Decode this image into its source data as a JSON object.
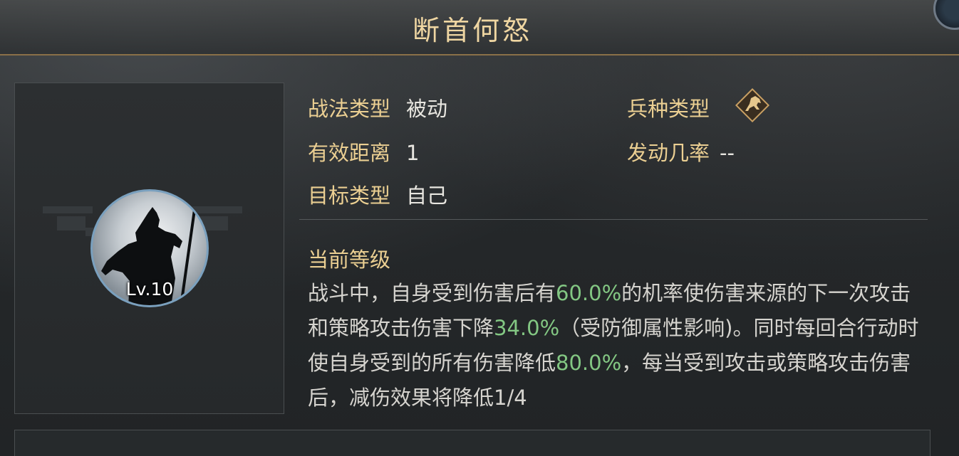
{
  "title": "断首何怒",
  "portrait": {
    "level": "Lv.10"
  },
  "info": {
    "tactic_type_label": "战法类型",
    "tactic_type_value": "被动",
    "range_label": "有效距离",
    "range_value": "1",
    "target_label": "目标类型",
    "target_value": "自己",
    "troop_type_label": "兵种类型",
    "troop_icon": "horse-cavalry-icon",
    "trigger_rate_label": "发动几率",
    "trigger_rate_value": "--"
  },
  "level_section": {
    "title": "当前等级",
    "desc_parts": [
      "战斗中，自身受到伤害后有",
      "60.0%",
      "的机率使伤害来源的下一次攻击和策略攻击伤害下降",
      "34.0%",
      "（受防御属性影响)。同时每回合行动时使自身受到的所有伤害降低",
      "80.0%",
      "，每当受到攻击或策略攻击伤害后，减伤效果将降低1/4"
    ]
  },
  "colors": {
    "label": "#ebcf92",
    "highlight": "#83c783",
    "divider": "#8a7048"
  }
}
